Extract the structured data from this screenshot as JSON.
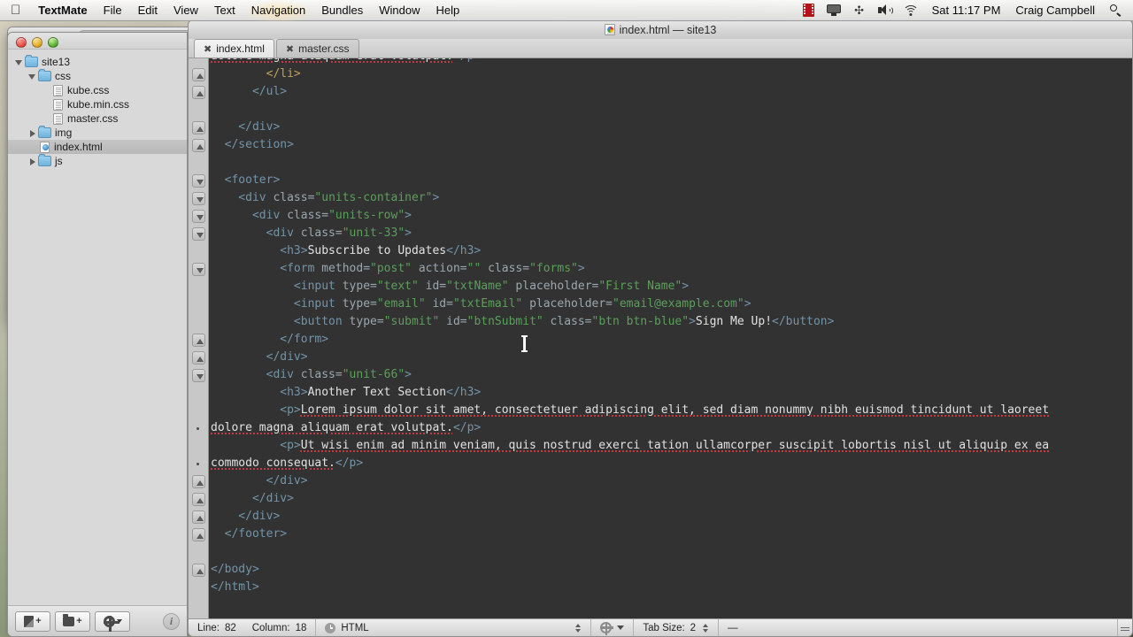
{
  "menubar": {
    "apple_icon": "apple-icon",
    "app_name": "TextMate",
    "items": [
      "File",
      "Edit",
      "View",
      "Text",
      "Navigation",
      "Bundles",
      "Window",
      "Help"
    ],
    "highlighted_item": "Navigation",
    "status": {
      "icons": [
        "film-icon",
        "display-icon",
        "bluetooth-icon",
        "volume-icon",
        "wifi-icon"
      ],
      "clock": "Sat 11:17 PM",
      "user": "Craig Campbell",
      "search_icon": "spotlight-search-icon"
    }
  },
  "window": {
    "title": "index.html — site13",
    "doc_icon": "html-document-icon",
    "traffic": [
      "close-button",
      "minimize-button",
      "zoom-button"
    ]
  },
  "sidebar": {
    "tree": [
      {
        "depth": 0,
        "twisty": "open",
        "icon": "folder-icon",
        "label": "site13",
        "selected": false
      },
      {
        "depth": 1,
        "twisty": "open",
        "icon": "folder-icon",
        "label": "css",
        "selected": false
      },
      {
        "depth": 2,
        "twisty": "none",
        "icon": "file-icon",
        "label": "kube.css",
        "selected": false
      },
      {
        "depth": 2,
        "twisty": "none",
        "icon": "file-icon",
        "label": "kube.min.css",
        "selected": false
      },
      {
        "depth": 2,
        "twisty": "none",
        "icon": "file-icon",
        "label": "master.css",
        "selected": false
      },
      {
        "depth": 1,
        "twisty": "closed",
        "icon": "folder-icon",
        "label": "img",
        "selected": false
      },
      {
        "depth": 1,
        "twisty": "none",
        "icon": "html-icon",
        "label": "index.html",
        "selected": true
      },
      {
        "depth": 1,
        "twisty": "closed",
        "icon": "folder-icon",
        "label": "js",
        "selected": false
      }
    ],
    "footer": {
      "new_file": "new-file-button",
      "new_folder": "new-folder-button",
      "actions": "actions-gear-button",
      "info": "i"
    }
  },
  "tabs": [
    {
      "label": "index.html",
      "active": true,
      "close": "✖"
    },
    {
      "label": "master.css",
      "active": false,
      "close": "✖"
    }
  ],
  "editor": {
    "lines": [
      {
        "fold": null,
        "wrap": true,
        "segs": [
          {
            "t": "dolore magna aliquam erat volutpat.",
            "c": "txt sp"
          },
          {
            "t": "</p>",
            "c": "tag"
          }
        ],
        "indent": 0
      },
      {
        "fold": "up",
        "wrap": false,
        "segs": [
          {
            "t": "        </li>",
            "c": "tag2"
          }
        ],
        "indent": 0
      },
      {
        "fold": "up",
        "wrap": false,
        "segs": [
          {
            "t": "      </ul>",
            "c": "tag"
          }
        ],
        "indent": 0
      },
      {
        "fold": null,
        "wrap": false,
        "segs": [
          {
            "t": "",
            "c": "txt"
          }
        ],
        "indent": 0
      },
      {
        "fold": "up",
        "wrap": false,
        "segs": [
          {
            "t": "    </div>",
            "c": "tag"
          }
        ],
        "indent": 0
      },
      {
        "fold": "up",
        "wrap": false,
        "segs": [
          {
            "t": "  </section>",
            "c": "tag"
          }
        ],
        "indent": 0
      },
      {
        "fold": null,
        "wrap": false,
        "segs": [
          {
            "t": "",
            "c": "txt"
          }
        ],
        "indent": 0
      },
      {
        "fold": "down",
        "wrap": false,
        "segs": [
          {
            "t": "  <footer>",
            "c": "tag"
          }
        ],
        "indent": 0
      },
      {
        "fold": "down",
        "wrap": false,
        "segs": [
          {
            "t": "    <div ",
            "c": "tag"
          },
          {
            "t": "class=",
            "c": "attr"
          },
          {
            "t": "\"units-container\"",
            "c": "val"
          },
          {
            "t": ">",
            "c": "tag"
          }
        ],
        "indent": 0
      },
      {
        "fold": "down",
        "wrap": false,
        "segs": [
          {
            "t": "      <div ",
            "c": "tag"
          },
          {
            "t": "class=",
            "c": "attr"
          },
          {
            "t": "\"units-row\"",
            "c": "val"
          },
          {
            "t": ">",
            "c": "tag"
          }
        ],
        "indent": 0
      },
      {
        "fold": "down",
        "wrap": false,
        "segs": [
          {
            "t": "        <div ",
            "c": "tag"
          },
          {
            "t": "class=",
            "c": "attr"
          },
          {
            "t": "\"unit-33\"",
            "c": "val"
          },
          {
            "t": ">",
            "c": "tag"
          }
        ],
        "indent": 0
      },
      {
        "fold": null,
        "wrap": false,
        "segs": [
          {
            "t": "          <h3>",
            "c": "tag"
          },
          {
            "t": "Subscribe to Updates",
            "c": "txt"
          },
          {
            "t": "</h3>",
            "c": "tag"
          }
        ],
        "indent": 0
      },
      {
        "fold": "down",
        "wrap": false,
        "segs": [
          {
            "t": "          <form ",
            "c": "tag"
          },
          {
            "t": "method=",
            "c": "attr"
          },
          {
            "t": "\"post\"",
            "c": "val"
          },
          {
            "t": " ",
            "c": "txt"
          },
          {
            "t": "action=",
            "c": "attr"
          },
          {
            "t": "\"\"",
            "c": "val"
          },
          {
            "t": " ",
            "c": "txt"
          },
          {
            "t": "class=",
            "c": "attr"
          },
          {
            "t": "\"forms\"",
            "c": "val"
          },
          {
            "t": ">",
            "c": "tag"
          }
        ],
        "indent": 0
      },
      {
        "fold": null,
        "wrap": false,
        "segs": [
          {
            "t": "            <input ",
            "c": "tag"
          },
          {
            "t": "type=",
            "c": "attr"
          },
          {
            "t": "\"text\"",
            "c": "val"
          },
          {
            "t": " ",
            "c": "txt"
          },
          {
            "t": "id=",
            "c": "attr"
          },
          {
            "t": "\"txtName\"",
            "c": "val"
          },
          {
            "t": " ",
            "c": "txt"
          },
          {
            "t": "placeholder=",
            "c": "attr"
          },
          {
            "t": "\"First Name\"",
            "c": "val"
          },
          {
            "t": ">",
            "c": "tag"
          }
        ],
        "indent": 0
      },
      {
        "fold": null,
        "wrap": false,
        "segs": [
          {
            "t": "            <input ",
            "c": "tag"
          },
          {
            "t": "type=",
            "c": "attr"
          },
          {
            "t": "\"email\"",
            "c": "val"
          },
          {
            "t": " ",
            "c": "txt"
          },
          {
            "t": "id=",
            "c": "attr"
          },
          {
            "t": "\"txtEmail\"",
            "c": "val"
          },
          {
            "t": " ",
            "c": "txt"
          },
          {
            "t": "placeholder=",
            "c": "attr"
          },
          {
            "t": "\"email@example.com\"",
            "c": "val"
          },
          {
            "t": ">",
            "c": "tag"
          }
        ],
        "indent": 0
      },
      {
        "fold": null,
        "wrap": false,
        "segs": [
          {
            "t": "            <button ",
            "c": "tag"
          },
          {
            "t": "type=",
            "c": "attr"
          },
          {
            "t": "\"submit\"",
            "c": "val"
          },
          {
            "t": " ",
            "c": "txt"
          },
          {
            "t": "id=",
            "c": "attr"
          },
          {
            "t": "\"btnSubmit\"",
            "c": "val"
          },
          {
            "t": " ",
            "c": "txt"
          },
          {
            "t": "class=",
            "c": "attr"
          },
          {
            "t": "\"btn btn-blue\"",
            "c": "val"
          },
          {
            "t": ">",
            "c": "tag"
          },
          {
            "t": "Sign Me Up!",
            "c": "txt"
          },
          {
            "t": "</button>",
            "c": "tag"
          }
        ],
        "indent": 0
      },
      {
        "fold": "up",
        "wrap": false,
        "segs": [
          {
            "t": "          </form>",
            "c": "tag"
          }
        ],
        "indent": 0
      },
      {
        "fold": "up",
        "wrap": false,
        "segs": [
          {
            "t": "        </div>",
            "c": "tag"
          }
        ],
        "indent": 0
      },
      {
        "fold": "down",
        "wrap": false,
        "segs": [
          {
            "t": "        <div ",
            "c": "tag"
          },
          {
            "t": "class=",
            "c": "attr"
          },
          {
            "t": "\"unit-66\"",
            "c": "val"
          },
          {
            "t": ">",
            "c": "tag"
          }
        ],
        "indent": 0
      },
      {
        "fold": null,
        "wrap": false,
        "segs": [
          {
            "t": "          <h3>",
            "c": "tag"
          },
          {
            "t": "Another Text Section",
            "c": "txt"
          },
          {
            "t": "</h3>",
            "c": "tag"
          }
        ],
        "indent": 0
      },
      {
        "fold": null,
        "wrap": false,
        "segs": [
          {
            "t": "          <p>",
            "c": "tag"
          },
          {
            "t": "Lorem ipsum dolor sit amet, consectetuer adipiscing elit, sed diam nonummy nibh euismod tincidunt ut laoreet",
            "c": "txt sp"
          }
        ],
        "indent": 0
      },
      {
        "fold": null,
        "wrap": true,
        "segs": [
          {
            "t": "dolore magna aliquam erat volutpat.",
            "c": "txt sp"
          },
          {
            "t": "</p>",
            "c": "tag"
          }
        ],
        "indent": 0
      },
      {
        "fold": null,
        "wrap": false,
        "segs": [
          {
            "t": "          <p>",
            "c": "tag"
          },
          {
            "t": "Ut wisi enim ad minim veniam, quis nostrud exerci tation ullamcorper suscipit lobortis nisl ut aliquip ex ea",
            "c": "txt sp"
          }
        ],
        "indent": 0
      },
      {
        "fold": null,
        "wrap": true,
        "segs": [
          {
            "t": "commodo consequat.",
            "c": "txt sp"
          },
          {
            "t": "</p>",
            "c": "tag"
          }
        ],
        "indent": 0
      },
      {
        "fold": "up",
        "wrap": false,
        "segs": [
          {
            "t": "        </div>",
            "c": "tag"
          }
        ],
        "indent": 0
      },
      {
        "fold": "up",
        "wrap": false,
        "segs": [
          {
            "t": "      </div>",
            "c": "tag"
          }
        ],
        "indent": 0
      },
      {
        "fold": "up",
        "wrap": false,
        "segs": [
          {
            "t": "    </div>",
            "c": "tag"
          }
        ],
        "indent": 0
      },
      {
        "fold": "up",
        "wrap": false,
        "segs": [
          {
            "t": "  </footer>",
            "c": "tag"
          }
        ],
        "indent": 0
      },
      {
        "fold": null,
        "wrap": false,
        "segs": [
          {
            "t": "",
            "c": "txt"
          }
        ],
        "indent": 0
      },
      {
        "fold": "up",
        "wrap": false,
        "segs": [
          {
            "t": "</body>",
            "c": "tag"
          }
        ],
        "indent": 0
      },
      {
        "fold": null,
        "wrap": false,
        "segs": [
          {
            "t": "</html>",
            "c": "tag"
          }
        ],
        "indent": 0
      }
    ]
  },
  "statusbar": {
    "line_label": "Line:",
    "line_value": "82",
    "column_label": "Column:",
    "column_value": "18",
    "language": "HTML",
    "language_icon": "clock-icon",
    "bundle_icon": "gear-icon",
    "tabsize_label": "Tab Size:",
    "tabsize_value": "2",
    "extra": "—"
  },
  "colors": {
    "editor_bg": "#323232",
    "tag": "#7394a8",
    "attr": "#9ba7ae",
    "value": "#5b9f5b",
    "text": "#e2e2e2",
    "spell_error": "#c4393f",
    "selection": "#c0c0c0"
  }
}
